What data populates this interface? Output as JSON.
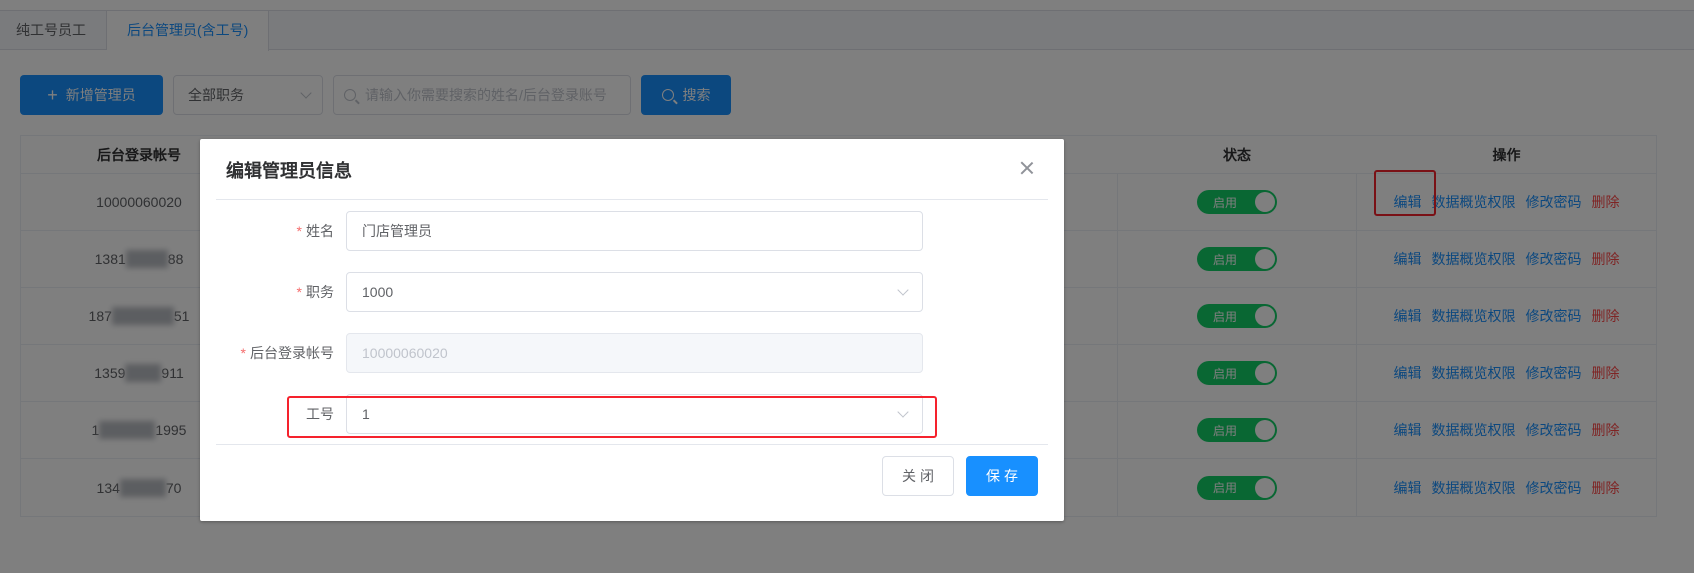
{
  "tabs": [
    {
      "label": "纯工号员工",
      "active": false
    },
    {
      "label": "后台管理员(含工号)",
      "active": true
    }
  ],
  "toolbar": {
    "add_label": "新增管理员",
    "role_filter": "全部职务",
    "search_placeholder": "请输入你需要搜索的姓名/后台登录账号",
    "search_label": "搜索"
  },
  "table": {
    "headers": {
      "account": "后台登录帐号",
      "status": "状态",
      "ops": "操作"
    },
    "rows": [
      {
        "pre": "10000060020",
        "post": "",
        "status": "启用"
      },
      {
        "pre": "1381",
        "post": "88",
        "status": "启用"
      },
      {
        "pre": "187",
        "post": "51",
        "status": "启用"
      },
      {
        "pre": "1359",
        "post": "911",
        "status": "启用"
      },
      {
        "pre": "1",
        "post": "1995",
        "status": "启用"
      },
      {
        "pre": "134",
        "post": "70",
        "status": "启用"
      }
    ],
    "ops": {
      "edit": "编辑",
      "data_perm": "数据概览权限",
      "change_pwd": "修改密码",
      "delete": "删除"
    }
  },
  "dialog": {
    "title": "编辑管理员信息",
    "fields": {
      "name": {
        "label": "姓名",
        "value": "门店管理员"
      },
      "role": {
        "label": "职务",
        "value": "1000"
      },
      "account": {
        "label": "后台登录帐号",
        "value": "10000060020"
      },
      "jobno": {
        "label": "工号",
        "value": "1"
      }
    },
    "cancel_label": "关闭",
    "save_label": "保存"
  },
  "colors": {
    "primary": "#1890ff",
    "success": "#13ce66",
    "danger": "#ff4949",
    "highlight": "#f5222d"
  }
}
